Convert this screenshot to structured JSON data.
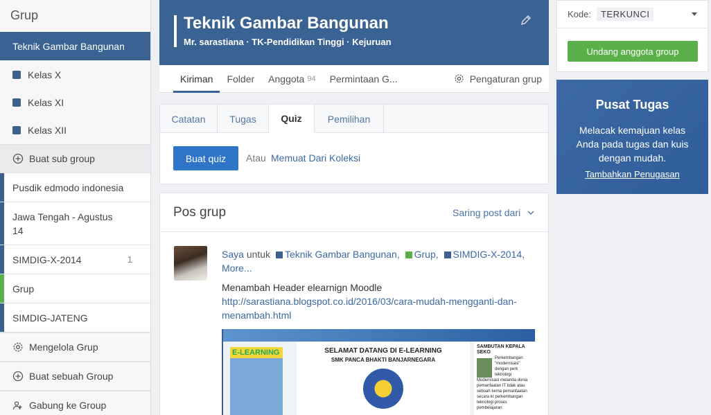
{
  "sidebar": {
    "title": "Grup",
    "active": "Teknik Gambar Bangunan",
    "subgroups": [
      "Kelas X",
      "Kelas XI",
      "Kelas XII"
    ],
    "create_subgroup": "Buat sub group",
    "groups": [
      {
        "label": "Pusdik edmodo indonesia",
        "color": "#3d5f8d",
        "count": ""
      },
      {
        "label": "Jawa Tengah - Agustus 14",
        "color": "#3d5f8d",
        "count": ""
      },
      {
        "label": "SIMDIG-X-2014",
        "color": "#3d5f8d",
        "count": "1"
      },
      {
        "label": "Grup",
        "color": "#5ab14a",
        "count": ""
      },
      {
        "label": "SIMDIG-JATENG",
        "color": "#3d5f8d",
        "count": ""
      }
    ],
    "manage": "Mengelola Grup",
    "create_group": "Buat sebuah Group",
    "join_group": "Gabung ke Group"
  },
  "header": {
    "title": "Teknik Gambar Bangunan",
    "subtitle": "Mr. sarastiana · TK-Pendidikan Tinggi · Kejuruan",
    "tabs": {
      "posts": "Kiriman",
      "folder": "Folder",
      "members": "Anggota",
      "members_count": "94",
      "requests": "Permintaan G...",
      "settings": "Pengaturan grup"
    }
  },
  "composer": {
    "tabs": [
      "Catatan",
      "Tugas",
      "Quiz",
      "Pemilihan"
    ],
    "button": "Buat quiz",
    "or": "Atau",
    "load": "Memuat Dari Koleksi"
  },
  "posts": {
    "title": "Pos grup",
    "filter": "Saring post dari",
    "post": {
      "author": "Saya",
      "to": "untuk",
      "targets": [
        {
          "label": "Teknik Gambar Bangunan,",
          "color": "#3d5f8d"
        },
        {
          "label": "Grup,",
          "color": "#5ab14a"
        },
        {
          "label": "SIMDIG-X-2014,",
          "color": "#3d5f8d"
        }
      ],
      "more": "More...",
      "text": "Menambah Header elearnign Moodle",
      "link": "http://sarastiana.blogspot.co.id/2016/03/cara-mudah-mengganti-dan-menambah.html",
      "preview": {
        "left_label": "E-LEARNING",
        "heading": "SELAMAT DATANG DI E-LEARNING",
        "school": "SMK PANCA BHAKTI BANJARNEGARA",
        "right_heading": "SAMBUTAN KEPALA SEKO",
        "right_text": "Perkembangan \"modernisasi\" dengan perk teknologi Modernisasi melanda dunia pemanfaatan IT tidak atau sebuah kema pemanfaatan secara kr perkembangan teknologi proses pembelajaran."
      }
    }
  },
  "right": {
    "code_label": "Kode:",
    "code_value": "TERKUNCI",
    "invite": "Undang anggota group",
    "assign_title": "Pusat Tugas",
    "assign_desc": "Melacak kemajuan kelas Anda pada tugas dan kuis dengan mudah.",
    "assign_link": "Tambahkan Penugasan"
  }
}
